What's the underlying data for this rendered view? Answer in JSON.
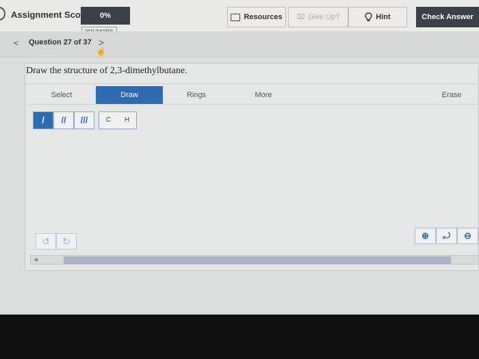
{
  "header": {
    "score_label": "Assignment Score:",
    "score_value": "0%",
    "tooltip": "next question",
    "resources_label": "Resources",
    "giveup_label": "Give Up?",
    "hint_label": "Hint",
    "check_label": "Check Answer"
  },
  "nav": {
    "prev_glyph": "<",
    "question_label": "Question 27 of 37",
    "next_glyph": ">"
  },
  "question": {
    "prompt": "Draw the structure of 2,3-dimethylbutane."
  },
  "editor": {
    "tabs": {
      "select": "Select",
      "draw": "Draw",
      "rings": "Rings",
      "more": "More",
      "erase": "Erase"
    },
    "active_tab": "draw",
    "bonds": [
      "/",
      "//",
      "///"
    ],
    "atoms": [
      "C",
      "H"
    ],
    "undo": "↺",
    "redo": "↻",
    "zoom_in": "⊕",
    "zoom_reset": "⤾",
    "zoom_out": "⊖"
  },
  "colors": {
    "accent": "#2e6bb0",
    "dark_button": "#3c4147"
  }
}
